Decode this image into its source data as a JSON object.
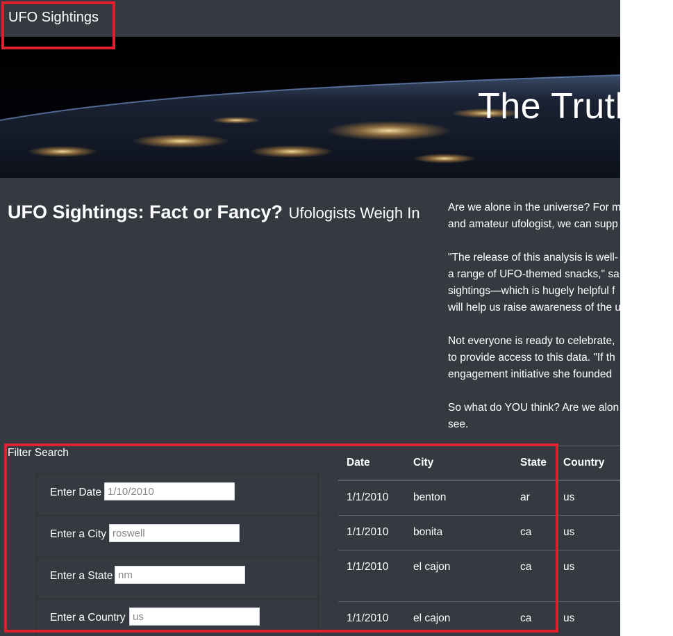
{
  "navbar": {
    "brand": "UFO Sightings"
  },
  "hero": {
    "title": "The Truth"
  },
  "headline": {
    "main": "UFO Sightings: Fact or Fancy?",
    "sub": "Ufologists Weigh In"
  },
  "article": {
    "p1_l1": "Are we alone in the universe? For m",
    "p1_l2": "and amateur ufologist, we can supp",
    "p2_l1": "\"The release of this analysis is well-",
    "p2_l2": "a range of UFO-themed snacks,\" sa",
    "p2_l3": "sightings—which is hugely helpful f",
    "p2_l4": "will help us raise awareness of the u",
    "p3_l1": "Not everyone is ready to celebrate,",
    "p3_l2": "to provide access to this data. \"If th",
    "p3_l3": "engagement initiative she founded",
    "p4_l1": "So what do YOU think? Are we alon",
    "p4_l2": "see."
  },
  "filter": {
    "title": "Filter Search",
    "date": {
      "label": "Enter Date",
      "placeholder": "1/10/2010"
    },
    "city": {
      "label": "Enter a City",
      "placeholder": "roswell"
    },
    "state": {
      "label": "Enter a State",
      "placeholder": "nm"
    },
    "country": {
      "label": "Enter a Country",
      "placeholder": "us"
    }
  },
  "table": {
    "headers": [
      "Date",
      "City",
      "State",
      "Country"
    ],
    "rows": [
      [
        "1/1/2010",
        "benton",
        "ar",
        "us"
      ],
      [
        "1/1/2010",
        "bonita",
        "ca",
        "us"
      ],
      [
        "1/1/2010",
        "el cajon",
        "ca",
        "us"
      ],
      [
        "1/1/2010",
        "el cajon",
        "ca",
        "us"
      ]
    ]
  },
  "colors": {
    "background": "#343a40",
    "highlight": "#e0202e",
    "text": "#ffffff"
  }
}
